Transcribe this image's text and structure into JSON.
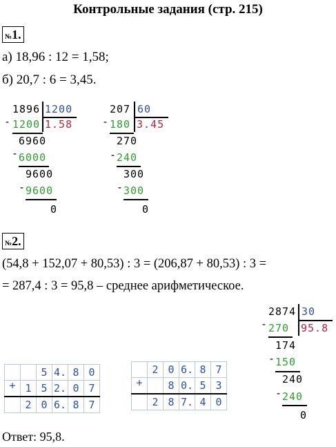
{
  "title": "Контрольные задания (стр. 215)",
  "task1": {
    "header_no": "№",
    "header_num": "1.",
    "line_a": "а) 18,96 : 12 = 1,58;",
    "line_b": "б) 20,7 : 6 = 3,45.",
    "div1": {
      "dividend": "1896",
      "divisor": "1200",
      "quotient": "1.58",
      "rows": [
        {
          "minus": "-",
          "val": "1200"
        },
        {
          "val": "6960"
        },
        {
          "minus": "-",
          "val": "6000"
        },
        {
          "val": "9600"
        },
        {
          "minus": "-",
          "val": "9600"
        },
        {
          "val": "0"
        }
      ]
    },
    "div2": {
      "dividend": "207",
      "divisor": "60",
      "quotient": "3.45",
      "rows": [
        {
          "minus": "-",
          "val": "180"
        },
        {
          "val": "270"
        },
        {
          "minus": "-",
          "val": "240"
        },
        {
          "val": "300"
        },
        {
          "minus": "-",
          "val": "300"
        },
        {
          "val": "0"
        }
      ]
    }
  },
  "task2": {
    "header_no": "№",
    "header_num": "2.",
    "line1": "(54,8 + 152,07 + 80,53) : 3 = (206,87 + 80,53) : 3 =",
    "line2": "= 287,4 : 3 = 95,8 – среднее арифметическое.",
    "div3": {
      "dividend": "2874",
      "divisor": "30",
      "quotient": "95.8",
      "rows": [
        {
          "minus": "-",
          "val": "270"
        },
        {
          "val": "174"
        },
        {
          "minus": "-",
          "val": "150"
        },
        {
          "val": "240"
        },
        {
          "minus": "-",
          "val": "240"
        },
        {
          "val": "0"
        }
      ]
    },
    "add1": {
      "plus": "+",
      "row1": [
        "",
        "",
        "5",
        "4.",
        "8",
        "0"
      ],
      "row2": [
        "",
        "1",
        "5",
        "2.",
        "0",
        "7"
      ],
      "sum": [
        "",
        "2",
        "0",
        "6.",
        "8",
        "7"
      ]
    },
    "add2": {
      "plus": "+",
      "row1": [
        "",
        "2",
        "0",
        "6.",
        "8",
        "7"
      ],
      "row2": [
        "",
        "",
        "8",
        "0.",
        "5",
        "3"
      ],
      "sum": [
        "",
        "2",
        "8",
        "7.",
        "4",
        "0"
      ]
    }
  },
  "answer": "Ответ: 95,8."
}
